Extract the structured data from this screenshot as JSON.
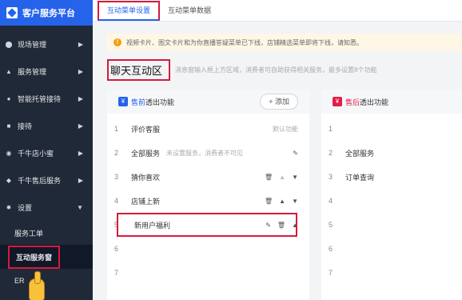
{
  "sidebar": {
    "logo_text": "客户服务平台",
    "items": [
      {
        "label": "现场管理",
        "icon": "location-icon"
      },
      {
        "label": "服务管理",
        "icon": "bell-icon"
      },
      {
        "label": "智能托管接待",
        "icon": "bulb-icon"
      },
      {
        "label": "接待",
        "icon": "bag-icon"
      },
      {
        "label": "千牛店小蜜",
        "icon": "headset-icon"
      },
      {
        "label": "千牛售后服务",
        "icon": "shield-icon"
      },
      {
        "label": "设置",
        "icon": "gear-icon"
      }
    ],
    "sub_items": [
      {
        "label": "服务工单"
      },
      {
        "label": "互动服务窗"
      },
      {
        "label": "ER"
      }
    ]
  },
  "tabs": [
    {
      "label": "互动菜单设置"
    },
    {
      "label": "互动菜单数据"
    }
  ],
  "notice": {
    "text": "视频卡片、图文卡片和为你直播答疑菜单已下线，店铺精选菜单即将下线，请知悉。"
  },
  "section": {
    "title": "聊天互动区",
    "desc": "消息窗输入框上方区域，消费者可自助获得相关服务，最多设置8个功能"
  },
  "card_left": {
    "badge": "¥",
    "title_accent": "售前",
    "title_rest": "透出功能",
    "add_label": "+ 添加",
    "rows": [
      {
        "num": "1",
        "text": "评价客服",
        "sub": "",
        "right": "默认功能"
      },
      {
        "num": "2",
        "text": "全部服务",
        "sub": "未设置服务，消费者不可见",
        "right": ""
      },
      {
        "num": "3",
        "text": "猜你喜欢",
        "sub": "",
        "right": ""
      },
      {
        "num": "4",
        "text": "店铺上新",
        "sub": "",
        "right": ""
      },
      {
        "num": "5",
        "text": "新用户福利",
        "sub": "",
        "right": ""
      },
      {
        "num": "6",
        "text": "",
        "sub": "",
        "right": ""
      },
      {
        "num": "7",
        "text": "",
        "sub": "",
        "right": ""
      }
    ]
  },
  "card_right": {
    "badge": "¥",
    "title_accent": "售后",
    "title_rest": "透出功能",
    "rows": [
      {
        "num": "1",
        "text": ""
      },
      {
        "num": "2",
        "text": "全部服务"
      },
      {
        "num": "3",
        "text": "订单查询"
      },
      {
        "num": "4",
        "text": ""
      },
      {
        "num": "5",
        "text": ""
      },
      {
        "num": "6",
        "text": ""
      },
      {
        "num": "7",
        "text": ""
      }
    ]
  },
  "colors": {
    "sidebar_bg": "#1f2937",
    "accent_blue": "#2563eb",
    "highlight_red": "#d61a3c",
    "post_sale_red": "#e11d48"
  }
}
